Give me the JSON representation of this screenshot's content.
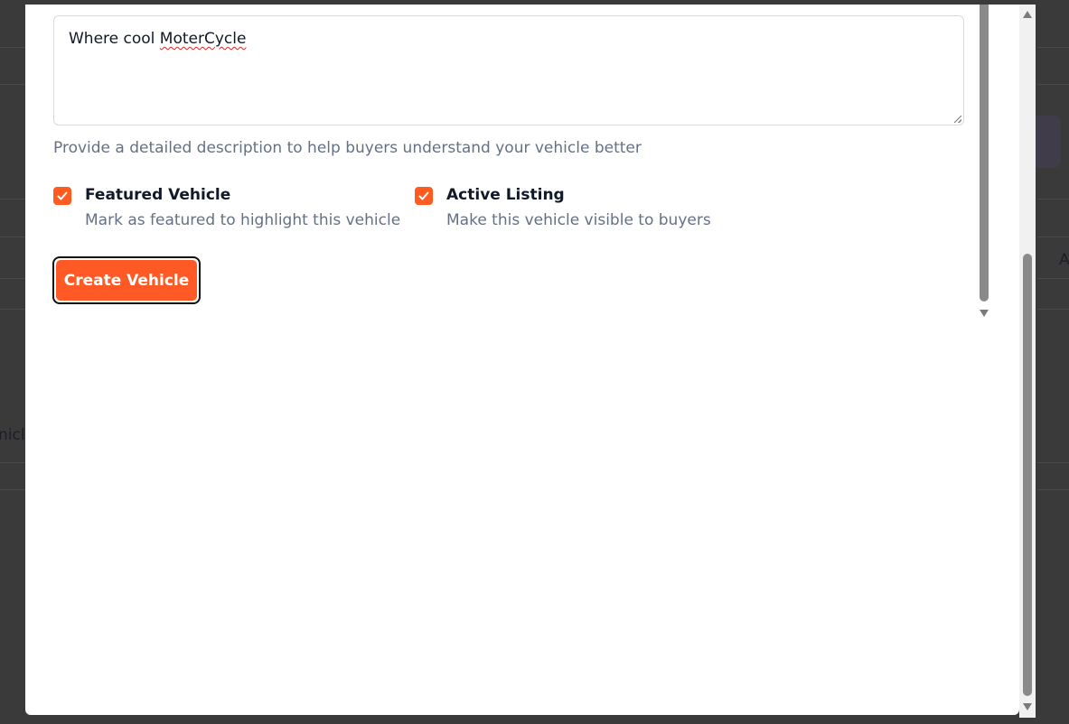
{
  "form": {
    "description_value": "Where cool ",
    "description_value_misspelled": "MoterCycle",
    "description_helper": "Provide a detailed description to help buyers understand your vehicle better",
    "featured": {
      "label": "Featured Vehicle",
      "description": "Mark as featured to highlight this vehicle",
      "checked": true
    },
    "active": {
      "label": "Active Listing",
      "description": "Make this vehicle visible to buyers",
      "checked": true
    },
    "submit_label": "Create Vehicle"
  },
  "background": {
    "partial_text_left": "nicl",
    "partial_text_right": "A"
  },
  "colors": {
    "accent": "#ff5a1f",
    "helper_text": "#667085",
    "overlay": "#3a3a3a"
  }
}
